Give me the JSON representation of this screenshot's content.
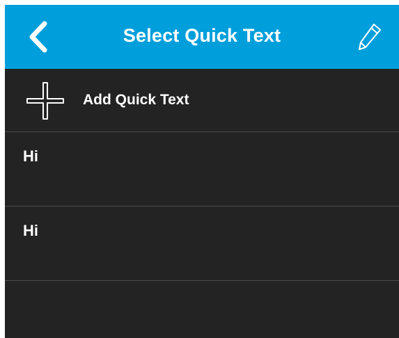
{
  "header": {
    "title": "Select Quick Text",
    "back_icon": "chevron-left-icon",
    "edit_icon": "pencil-icon",
    "background_color": "#009fdb"
  },
  "add_row": {
    "icon": "plus-icon",
    "label": "Add Quick Text"
  },
  "quick_texts": [
    {
      "label": "Hi"
    },
    {
      "label": "Hi"
    }
  ],
  "colors": {
    "list_background": "#232323",
    "divider": "#4a4a4a",
    "text": "#ffffff"
  }
}
